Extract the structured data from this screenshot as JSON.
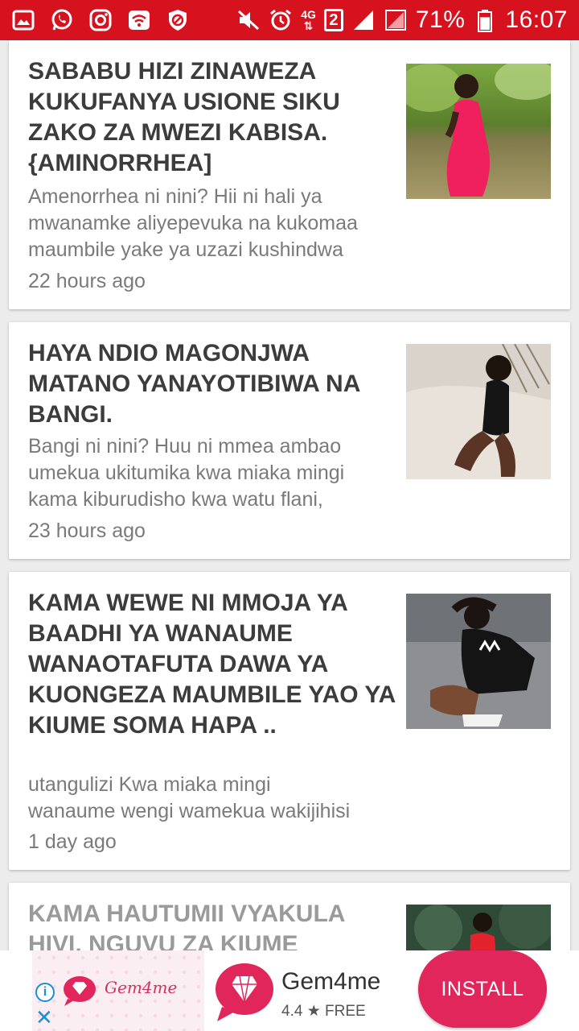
{
  "status_bar": {
    "left_icons": [
      "gallery-icon",
      "whatsapp-icon",
      "instagram-icon",
      "wifi-hotspot-icon",
      "block-icon"
    ],
    "network_label": "4G",
    "sim_badge": "2",
    "battery_percent": "71%",
    "battery_level": 0.71,
    "time": "16:07"
  },
  "articles": [
    {
      "title": "SABABU HIZI ZINAWEZA KUKUFANYA USIONE SIKU ZAKO ZA MWEZI KABISA.{AMINORRHEA]",
      "title_lines": [
        "SABABU HIZI ZINAWEZA",
        "KUKUFANYA USIONE SIKU",
        "ZAKO ZA MWEZI KABISA.",
        "{AMINORRHEA]"
      ],
      "excerpt_lines": [
        "Amenorrhea ni nini? Hii ni hali ya",
        "mwanamke aliyepevuka na kukomaa",
        "maumbile yake ya uzazi kushindwa"
      ],
      "time": "22 hours ago"
    },
    {
      "title": "HAYA NDIO MAGONJWA MATANO YANAYOTIBIWA NA BANGI.",
      "title_lines": [
        "HAYA NDIO MAGONJWA",
        "MATANO YANAYOTIBIWA NA",
        "BANGI."
      ],
      "excerpt_lines": [
        "Bangi ni nini? Huu ni mmea ambao",
        "umekua ukitumika kwa miaka mingi",
        "kama kiburudisho kwa watu flani,"
      ],
      "time": "23 hours ago"
    },
    {
      "title": "KAMA WEWE NI MMOJA YA BAADHI YA WANAUME WANAOTAFUTA DAWA YA KUONGEZA MAUMBILE YAO YA KIUME SOMA HAPA ..",
      "title_lines": [
        "KAMA WEWE NI MMOJA YA",
        "BAADHI YA WANAUME",
        "WANAOTAFUTA DAWA YA",
        "KUONGEZA MAUMBILE YAO YA",
        "KIUME SOMA HAPA .."
      ],
      "excerpt_lines": [
        "utangulizi Kwa miaka mingi",
        "wanaume wengi wamekua wakijihisi"
      ],
      "time": "1 day ago"
    },
    {
      "title": "KAMA HAUTUMII VYAKULA HIVI, NGUVU ZA KIUME",
      "title_lines": [
        "KAMA HAUTUMII VYAKULA",
        "HIVI, NGUVU ZA KIUME"
      ]
    }
  ],
  "ad": {
    "banner_label": "Gem4me",
    "app_name": "Gem4me",
    "rating": "4.4",
    "price": "FREE",
    "install_label": "INSTALL",
    "accent_color": "#e0265a"
  },
  "colors": {
    "status_bar": "#d7121f",
    "title_text": "#3c3c3c",
    "meta_text": "#7a7a7a"
  }
}
